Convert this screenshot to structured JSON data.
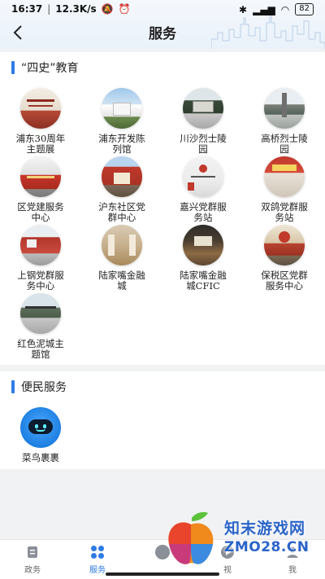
{
  "status_bar": {
    "time": "16:37",
    "network_speed": "12.3K/s",
    "battery": "82"
  },
  "header": {
    "title": "服务"
  },
  "history_section": {
    "title": "“四史”教育",
    "items": [
      {
        "label": "浦东30周年主题展"
      },
      {
        "label": "浦东开发陈列馆"
      },
      {
        "label": "川沙烈士陵园"
      },
      {
        "label": "高桥烈士陵园"
      },
      {
        "label": "区党建服务中心"
      },
      {
        "label": "沪东社区党群中心"
      },
      {
        "label": "嘉兴党群服务站"
      },
      {
        "label": "双鸽党群服务站"
      },
      {
        "label": "上钢党群服务中心"
      },
      {
        "label": "陆家嘴金融城"
      },
      {
        "label": "陆家嘴金融城CFIC"
      },
      {
        "label": "保税区党群服务中心"
      },
      {
        "label": "红色泥城主题馆"
      }
    ]
  },
  "services_section": {
    "title": "便民服务",
    "items": [
      {
        "label": "菜鸟裹裹"
      }
    ]
  },
  "tabbar": {
    "tabs": [
      {
        "label": "政务"
      },
      {
        "label": "服务"
      },
      {
        "label": ""
      },
      {
        "label": "视"
      },
      {
        "label": "我"
      }
    ]
  },
  "watermark": {
    "line1": "知末游戏网",
    "line2": "ZMO28.CN"
  },
  "colors": {
    "accent": "#2f7be6"
  }
}
